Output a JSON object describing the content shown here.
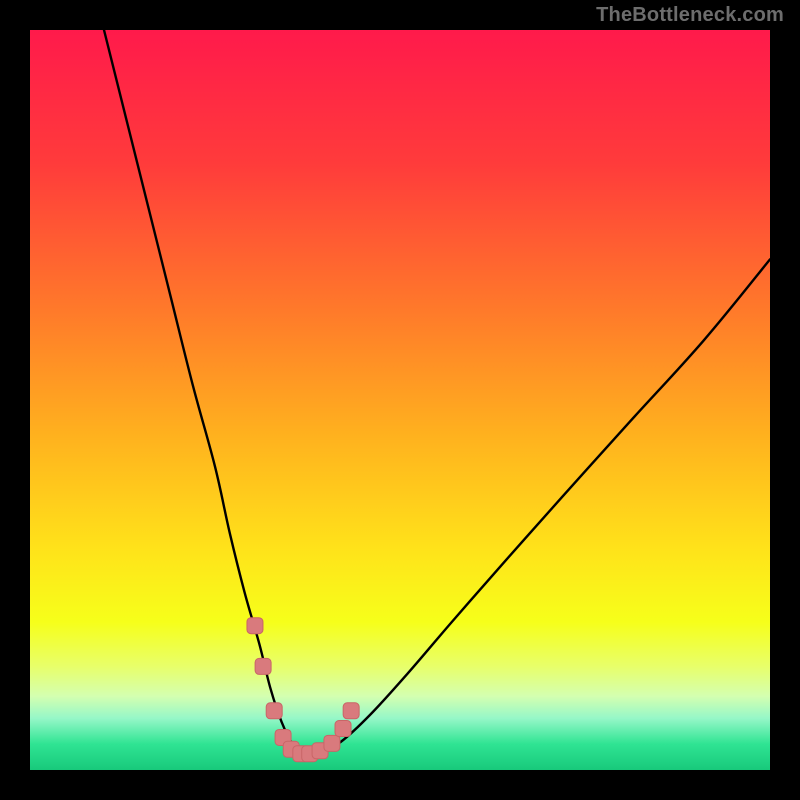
{
  "watermark": "TheBottleneck.com",
  "colors": {
    "frame": "#000000",
    "watermark": "#6d6d6d",
    "gradient_stops": [
      {
        "offset": 0.0,
        "color": "#ff1a4b"
      },
      {
        "offset": 0.18,
        "color": "#ff3b3b"
      },
      {
        "offset": 0.38,
        "color": "#ff7a2a"
      },
      {
        "offset": 0.55,
        "color": "#ffb21e"
      },
      {
        "offset": 0.7,
        "color": "#ffe21a"
      },
      {
        "offset": 0.8,
        "color": "#f6ff1a"
      },
      {
        "offset": 0.86,
        "color": "#e8ff6a"
      },
      {
        "offset": 0.9,
        "color": "#d4ffb0"
      },
      {
        "offset": 0.93,
        "color": "#96f7c8"
      },
      {
        "offset": 0.965,
        "color": "#2fe493"
      },
      {
        "offset": 1.0,
        "color": "#18c97b"
      }
    ],
    "curve": "#000000",
    "marker_fill": "#d97a7d",
    "marker_stroke": "#c96567"
  },
  "chart_data": {
    "type": "line",
    "title": "",
    "xlabel": "",
    "ylabel": "",
    "xlim": [
      0,
      100
    ],
    "ylim": [
      0,
      100
    ],
    "grid": false,
    "series": [
      {
        "name": "bottleneck-curve",
        "x": [
          10,
          13,
          16,
          19,
          22,
          25,
          27,
          29,
          31,
          32.5,
          34,
          35.5,
          37,
          39,
          42,
          46,
          51,
          57,
          64,
          72,
          81,
          91,
          100
        ],
        "y": [
          100,
          88,
          76,
          64,
          52,
          41,
          32,
          24,
          17,
          11,
          6.5,
          3.5,
          2.2,
          2.2,
          3.8,
          7.5,
          13,
          20,
          28,
          37,
          47,
          58,
          69
        ]
      }
    ],
    "markers": {
      "name": "highlight-points",
      "x": [
        30.4,
        31.5,
        33.0,
        34.2,
        35.3,
        36.6,
        37.8,
        39.2,
        40.8,
        42.3,
        43.4
      ],
      "y": [
        19.5,
        14.0,
        8.0,
        4.4,
        2.8,
        2.2,
        2.2,
        2.6,
        3.6,
        5.6,
        8.0
      ]
    }
  }
}
